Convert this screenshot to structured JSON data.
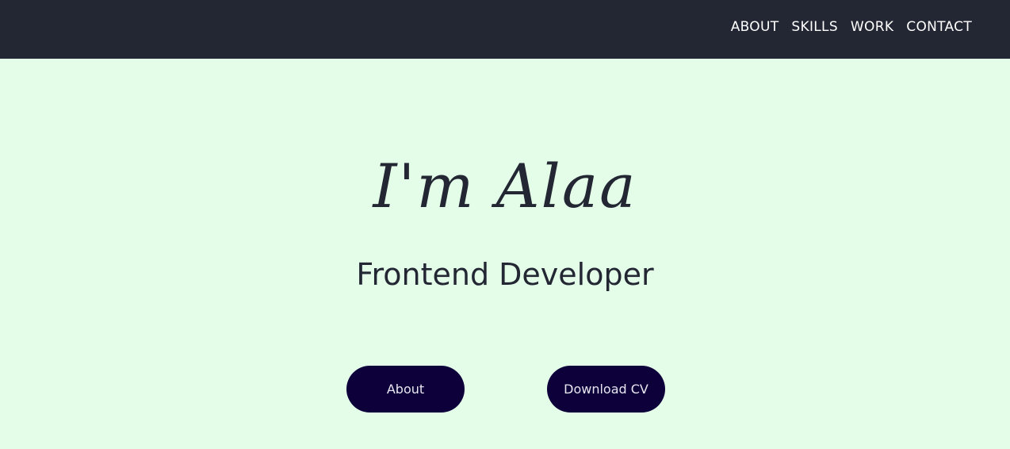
{
  "nav": {
    "links": [
      "ABOUT",
      "SKILLS",
      "WORK",
      "CONTACT"
    ]
  },
  "hero": {
    "name": "I'm Alaa",
    "role": "Frontend Developer"
  },
  "buttons": {
    "about_label": "About",
    "cv_label": "Download CV"
  },
  "colors": {
    "navbar_bg": "#232733",
    "page_bg": "#e4fde8",
    "button_bg": "#0d003a",
    "text_dark": "#232733"
  }
}
